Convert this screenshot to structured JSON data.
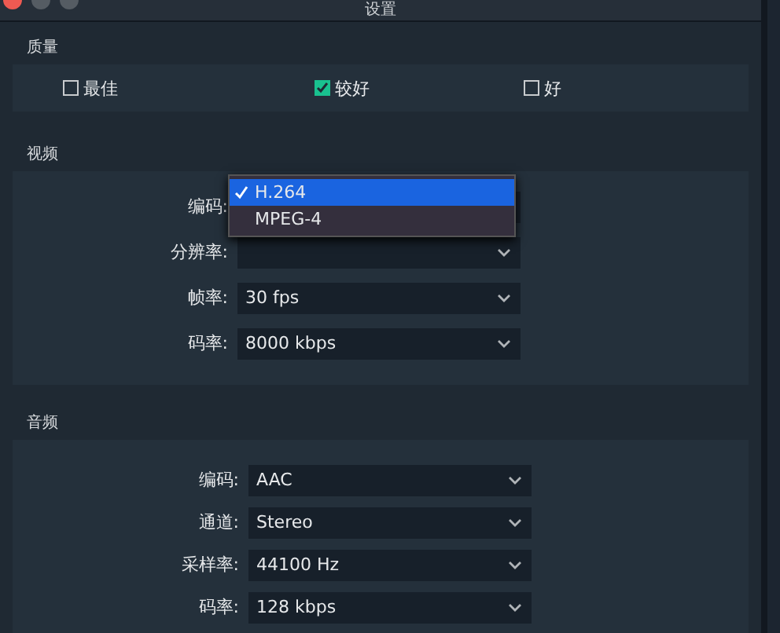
{
  "window": {
    "title": "设置"
  },
  "quality": {
    "title": "质量",
    "options": [
      {
        "label": "最佳",
        "checked": false
      },
      {
        "label": "较好",
        "checked": true
      },
      {
        "label": "好",
        "checked": false
      }
    ]
  },
  "video": {
    "title": "视频",
    "rows": [
      {
        "label": "编码:",
        "open": true,
        "menu": [
          {
            "label": "H.264",
            "selected": true
          },
          {
            "label": "MPEG-4",
            "selected": false
          }
        ]
      },
      {
        "label": "分辨率:"
      },
      {
        "label": "帧率:",
        "value": "30 fps"
      },
      {
        "label": "码率:",
        "value": "8000 kbps"
      }
    ]
  },
  "audio": {
    "title": "音频",
    "rows": [
      {
        "label": "编码:",
        "value": "AAC"
      },
      {
        "label": "通道:",
        "value": "Stereo"
      },
      {
        "label": "采样率:",
        "value": "44100 Hz"
      },
      {
        "label": "码率:",
        "value": "128 kbps"
      }
    ]
  }
}
